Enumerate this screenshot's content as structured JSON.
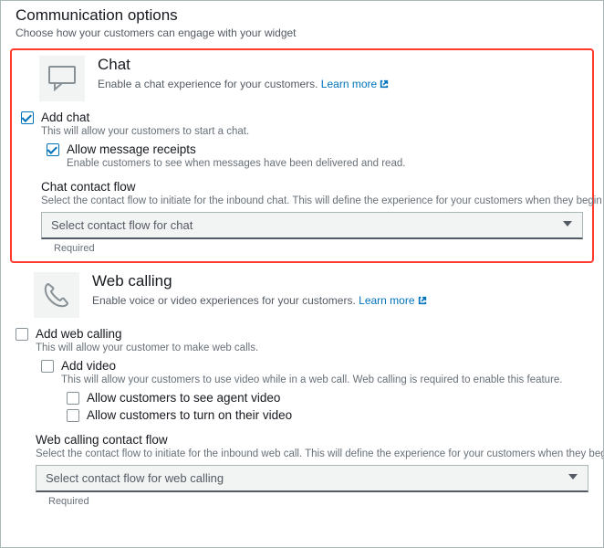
{
  "panel": {
    "title": "Communication options",
    "desc": "Choose how your customers can engage with your widget"
  },
  "chat": {
    "title": "Chat",
    "desc": "Enable a chat experience for your customers. ",
    "learn": "Learn more",
    "addLabel": "Add chat",
    "addDesc": "This will allow your customers to start a chat.",
    "receiptsLabel": "Allow message receipts",
    "receiptsDesc": "Enable customers to see when messages have been delivered and read.",
    "flowTitle": "Chat contact flow",
    "flowDesc": "Select the contact flow to initiate for the inbound chat. This will define the experience for your customers when they begin a new chat.",
    "flowPlaceholder": "Select contact flow for chat",
    "required": "Required"
  },
  "web": {
    "title": "Web calling",
    "desc": "Enable voice or video experiences for your customers. ",
    "learn": "Learn more",
    "addLabel": "Add web calling",
    "addDesc": "This will allow your customer to make web calls.",
    "videoLabel": "Add video",
    "videoDesc": "This will allow your customers to use video while in a web call. Web calling is required to enable this feature.",
    "agentVideo": "Allow customers to see agent video",
    "customerVideo": "Allow customers to turn on their video",
    "flowTitle": "Web calling contact flow",
    "flowDesc": "Select the contact flow to initiate for the inbound web call. This will define the experience for your customers when they begin a new web call.",
    "flowPlaceholder": "Select contact flow for web calling",
    "required": "Required"
  }
}
